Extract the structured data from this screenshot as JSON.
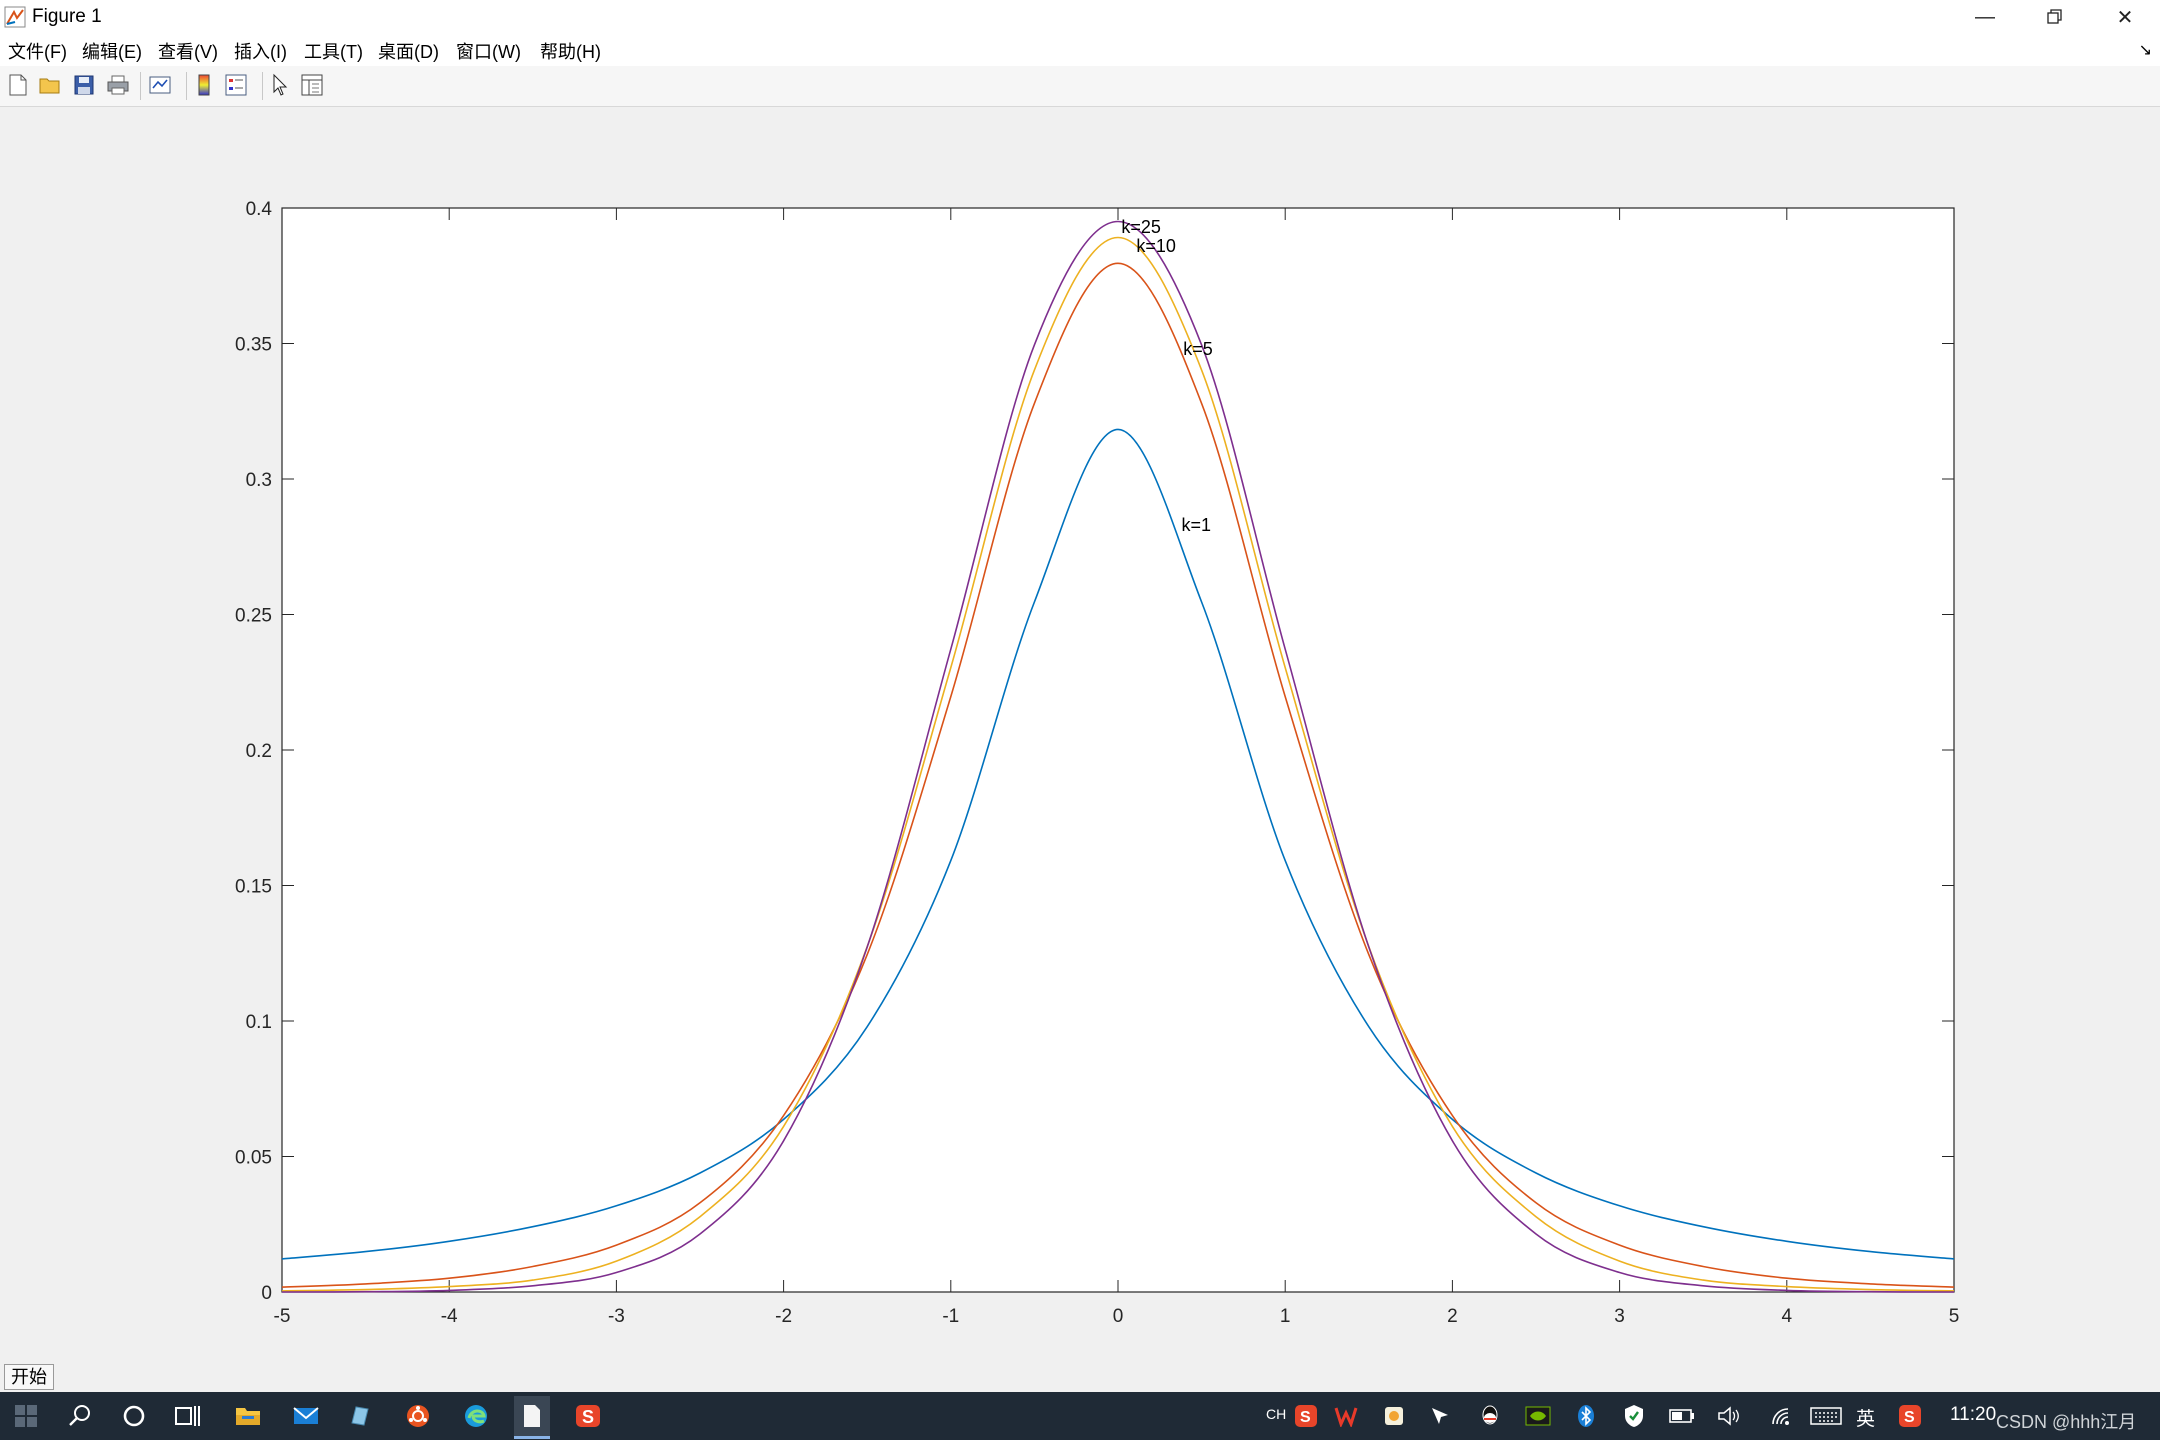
{
  "window": {
    "title": "Figure 1"
  },
  "menu": [
    "文件(F)",
    "编辑(E)",
    "查看(V)",
    "插入(I)",
    "工具(T)",
    "桌面(D)",
    "窗口(W)",
    "帮助(H)"
  ],
  "toolbar": {
    "icons": [
      "new-figure-icon",
      "open-icon",
      "save-icon",
      "print-icon",
      "link-plot-icon",
      "colorbar-icon",
      "legend-icon",
      "edit-arrow-icon",
      "property-inspector-icon"
    ]
  },
  "chart_data": {
    "type": "line",
    "title": "",
    "xlabel": "",
    "ylabel": "",
    "xlim": [
      -5,
      5
    ],
    "ylim": [
      0,
      0.4
    ],
    "xticks": [
      "-5",
      "-4",
      "-3",
      "-2",
      "-1",
      "0",
      "1",
      "2",
      "3",
      "4",
      "5"
    ],
    "yticks": [
      "0",
      "0.05",
      "0.1",
      "0.15",
      "0.2",
      "0.25",
      "0.3",
      "0.35",
      "0.4"
    ],
    "grid": false,
    "x": [
      -5,
      -4.5,
      -4,
      -3.5,
      -3,
      -2.5,
      -2,
      -1.5,
      -1,
      -0.5,
      0,
      0.5,
      1,
      1.5,
      2,
      2.5,
      3,
      3.5,
      4,
      4.5,
      5
    ],
    "series": [
      {
        "name": "k=1",
        "color": "#0072bd",
        "values": [
          0.0122,
          0.0149,
          0.0187,
          0.0241,
          0.0318,
          0.0439,
          0.0637,
          0.0979,
          0.1592,
          0.2546,
          0.3183,
          0.2546,
          0.1592,
          0.0979,
          0.0637,
          0.0439,
          0.0318,
          0.0241,
          0.0187,
          0.0149,
          0.0122
        ]
      },
      {
        "name": "k=5",
        "color": "#d95319",
        "values": [
          0.0018,
          0.003,
          0.0051,
          0.0094,
          0.0173,
          0.0329,
          0.0651,
          0.1245,
          0.2197,
          0.3279,
          0.3796,
          0.3279,
          0.2197,
          0.1245,
          0.0651,
          0.0329,
          0.0173,
          0.0094,
          0.0051,
          0.003,
          0.0018
        ]
      },
      {
        "name": "k=10",
        "color": "#edb120",
        "values": [
          0.0004,
          0.0009,
          0.002,
          0.0044,
          0.0114,
          0.0278,
          0.0611,
          0.1274,
          0.2304,
          0.3402,
          0.3891,
          0.3402,
          0.2304,
          0.1274,
          0.0611,
          0.0278,
          0.0114,
          0.0044,
          0.002,
          0.0009,
          0.0004
        ]
      },
      {
        "name": "k=25",
        "color": "#7e2f8e",
        "values": [
          0.0,
          0.0001,
          0.0006,
          0.0023,
          0.0072,
          0.0214,
          0.0558,
          0.1273,
          0.2372,
          0.3495,
          0.395,
          0.3495,
          0.2372,
          0.1273,
          0.0558,
          0.0214,
          0.0072,
          0.0023,
          0.0006,
          0.0001,
          0.0
        ]
      }
    ],
    "annotations": [
      {
        "text": "k=25",
        "x": 0.02,
        "y": 0.393
      },
      {
        "text": "k=10",
        "x": 0.11,
        "y": 0.386
      },
      {
        "text": "k=5",
        "x": 0.39,
        "y": 0.348
      },
      {
        "text": "k=1",
        "x": 0.38,
        "y": 0.283
      }
    ]
  },
  "start_button": {
    "label": "开始"
  },
  "taskbar": {
    "icons": [
      "windows-start-icon",
      "search-icon",
      "cortana-icon",
      "task-view-icon",
      "file-explorer-icon",
      "mail-icon",
      "app-icon",
      "ubuntu-icon",
      "edge-icon",
      "notepad-icon",
      "sogou-icon"
    ],
    "tray": {
      "ime_code": "CH",
      "ime_lang": "英",
      "clock": "11:20",
      "watermark": "CSDN @hhh江月"
    }
  }
}
